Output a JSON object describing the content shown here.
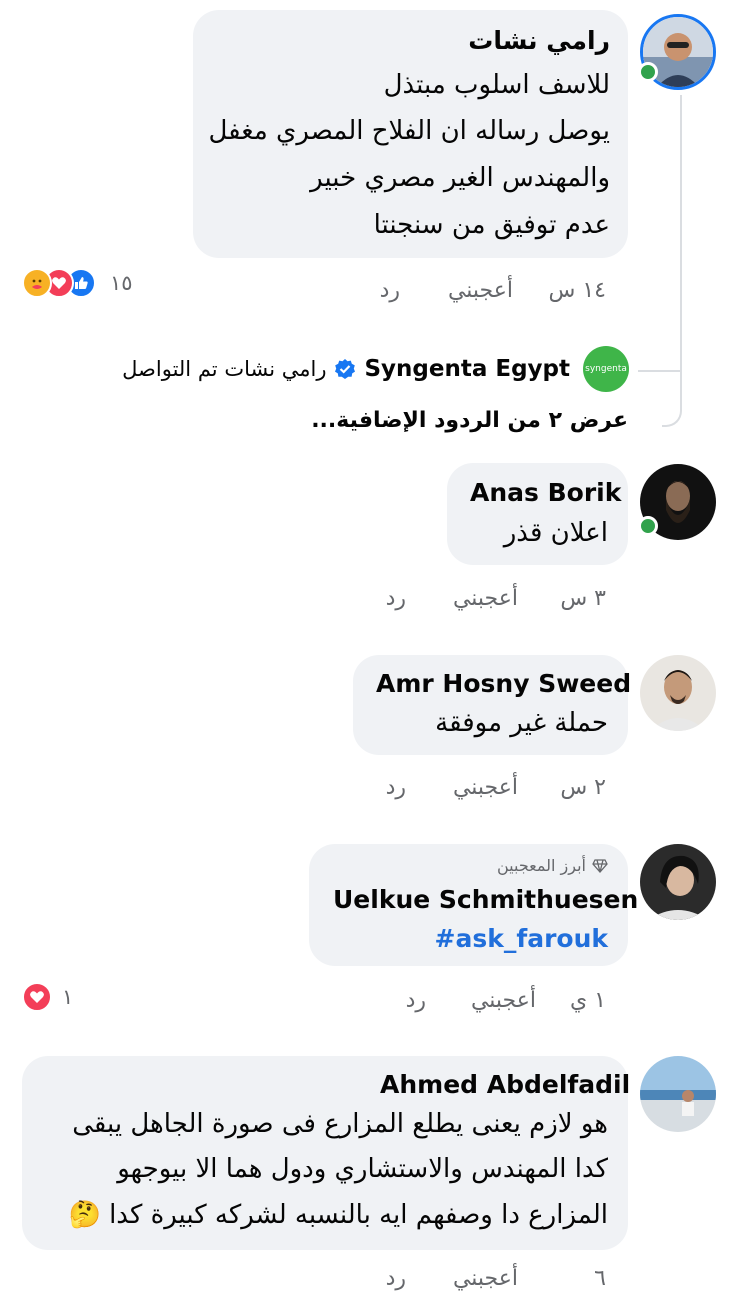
{
  "comments": [
    {
      "author": "رامي نشات",
      "lines": [
        "للاسف اسلوب مبتذل",
        "يوصل رساله ان الفلاح المصري مغفل",
        "والمهندس الغير مصري خبير",
        "عدم توفيق من سنجنتا"
      ],
      "time": "١٤ س",
      "like": "أعجبني",
      "reply": "رد",
      "reaction_count": "١٥"
    },
    {
      "author": "Anas Borik",
      "lines": [
        "اعلان قذر"
      ],
      "time": "٣ س",
      "like": "أعجبني",
      "reply": "رد"
    },
    {
      "author": "Amr Hosny Sweed",
      "lines": [
        "حملة غير موفقة"
      ],
      "time": "٢ س",
      "like": "أعجبني",
      "reply": "رد"
    },
    {
      "badge": "أبرز المعجبين",
      "author": "Uelkue Schmithuesen",
      "hashtag": "#ask_farouk",
      "time": "١ ي",
      "like": "أعجبني",
      "reply": "رد",
      "reaction_count": "١"
    },
    {
      "author": "Ahmed Abdelfadil",
      "lines": [
        "هو لازم يعنى يطلع المزارع فى صورة الجاهل يبقى",
        "كدا المهندس والاستشاري ودول هما الا بيوجهو",
        "المزارع دا وصفهم ايه بالنسبه لشركه كبيرة كدا 🤔"
      ],
      "time": "٦",
      "like": "أعجبني",
      "reply": "رد"
    }
  ],
  "reply_preview": {
    "page_name": "Syngenta Egypt",
    "logo_text": "syngenta",
    "text": "رامي نشات تم التواصل"
  },
  "more_replies": "عرض ٢ من الردود الإضافية...",
  "colors": {
    "bubble": "#f0f2f5",
    "online": "#31a24c",
    "link": "#216fdb",
    "syngenta": "#3fb549",
    "verified": "#1877f2"
  }
}
